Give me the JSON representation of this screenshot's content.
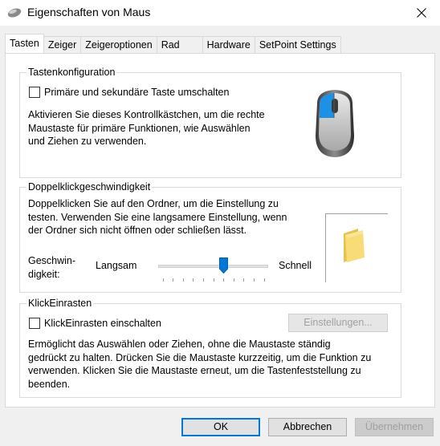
{
  "window": {
    "title": "Eigenschaften von Maus"
  },
  "tabs": [
    {
      "label": "Tasten"
    },
    {
      "label": "Zeiger"
    },
    {
      "label": "Zeigeroptionen"
    },
    {
      "label": "Rad"
    },
    {
      "label": "Hardware"
    },
    {
      "label": "SetPoint Settings"
    }
  ],
  "button_config": {
    "group_title": "Tastenkonfiguration",
    "checkbox_label": "Primäre und sekundäre Taste umschalten",
    "checked": false,
    "description_lines": [
      "Aktivieren Sie dieses Kontrollkästchen, um die rechte",
      "Maustaste für primäre Funktionen, wie Auswählen",
      "und Ziehen zu verwenden."
    ]
  },
  "double_click": {
    "group_title": "Doppelklickgeschwindigkeit",
    "description_lines": [
      "Doppelklicken Sie auf den Ordner, um die Einstellung zu",
      "testen. Verwenden Sie eine langsamere Einstellung, wenn",
      "der Ordner sich nicht öffnen oder schließen lässt."
    ],
    "speed_label_line1": "Geschwin-",
    "speed_label_line2": "digkeit:",
    "slow_label": "Langsam",
    "fast_label": "Schnell",
    "speed_fraction": 0.6
  },
  "click_lock": {
    "group_title": "KlickEinrasten",
    "checkbox_label": "KlickEinrasten einschalten",
    "checked": false,
    "settings_button": "Einstellungen...",
    "description_lines": [
      "Ermöglicht das Auswählen oder Ziehen, ohne die Maustaste ständig",
      "gedrückt zu halten. Drücken Sie die Maustaste kurzzeitig, um die Funktion zu",
      "verwenden. Klicken Sie die Maustaste erneut, um die Tastenfeststellung zu",
      "beenden."
    ]
  },
  "footer": {
    "ok": "OK",
    "cancel": "Abbrechen",
    "apply": "Übernehmen"
  },
  "colors": {
    "accent": "#0078d7",
    "mouse_button_highlight": "#1e90e6",
    "folder": "#f5d76e"
  }
}
